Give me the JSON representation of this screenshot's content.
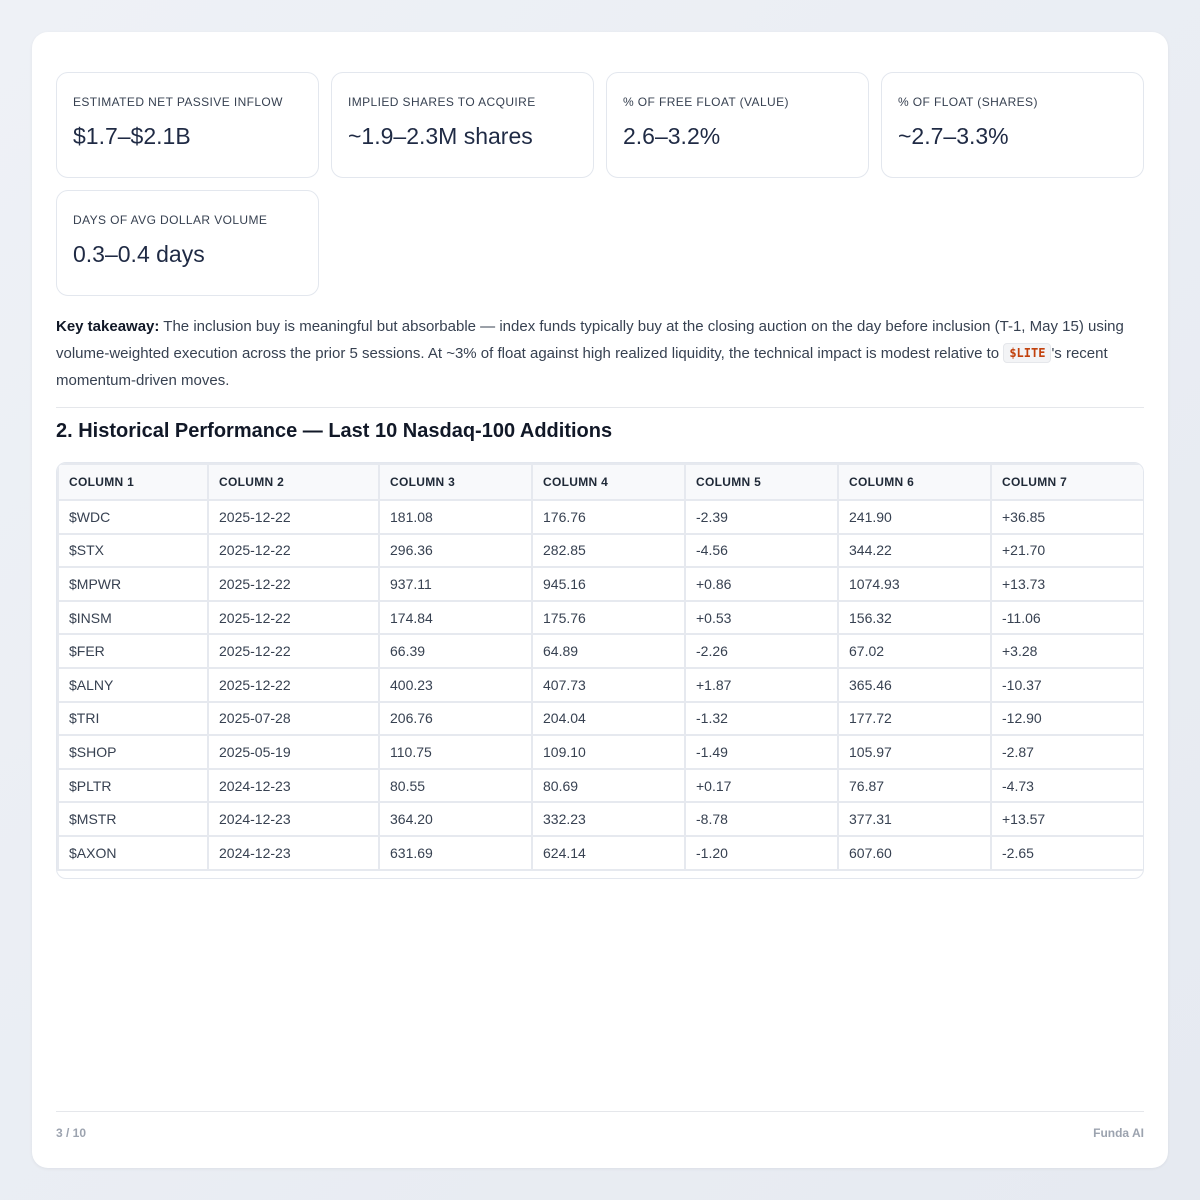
{
  "metrics": [
    {
      "label": "Estimated Net Passive Inflow",
      "value": "$1.7–$2.1B"
    },
    {
      "label": "Implied Shares to Acquire",
      "value": "~1.9–2.3M shares"
    },
    {
      "label": "% of Free Float (Value)",
      "value": "2.6–3.2%"
    },
    {
      "label": "% of Float (Shares)",
      "value": "~2.7–3.3%"
    },
    {
      "label": "Days of Avg Dollar Volume",
      "value": "0.3–0.4 days"
    }
  ],
  "takeaway": {
    "label": "Key takeaway:",
    "text_before": " The inclusion buy is meaningful but absorbable — index funds typically buy at the closing auction on the day before inclusion (T-1, May 15) using volume-weighted execution across the prior 5 sessions. At ~3% of float against high realized liquidity, the technical impact is modest relative to ",
    "ticker": "$LITE",
    "text_after": "'s recent momentum-driven moves."
  },
  "section_title": "2. Historical Performance — Last 10 Nasdaq-100 Additions",
  "table": {
    "headers": [
      "Column 1",
      "Column 2",
      "Column 3",
      "Column 4",
      "Column 5",
      "Column 6",
      "Column 7"
    ],
    "rows": [
      [
        "$WDC",
        "2025-12-22",
        "181.08",
        "176.76",
        "-2.39",
        "241.90",
        "+36.85"
      ],
      [
        "$STX",
        "2025-12-22",
        "296.36",
        "282.85",
        "-4.56",
        "344.22",
        "+21.70"
      ],
      [
        "$MPWR",
        "2025-12-22",
        "937.11",
        "945.16",
        "+0.86",
        "1074.93",
        "+13.73"
      ],
      [
        "$INSM",
        "2025-12-22",
        "174.84",
        "175.76",
        "+0.53",
        "156.32",
        "-11.06"
      ],
      [
        "$FER",
        "2025-12-22",
        "66.39",
        "64.89",
        "-2.26",
        "67.02",
        "+3.28"
      ],
      [
        "$ALNY",
        "2025-12-22",
        "400.23",
        "407.73",
        "+1.87",
        "365.46",
        "-10.37"
      ],
      [
        "$TRI",
        "2025-07-28",
        "206.76",
        "204.04",
        "-1.32",
        "177.72",
        "-12.90"
      ],
      [
        "$SHOP",
        "2025-05-19",
        "110.75",
        "109.10",
        "-1.49",
        "105.97",
        "-2.87"
      ],
      [
        "$PLTR",
        "2024-12-23",
        "80.55",
        "80.69",
        "+0.17",
        "76.87",
        "-4.73"
      ],
      [
        "$MSTR",
        "2024-12-23",
        "364.20",
        "332.23",
        "-8.78",
        "377.31",
        "+13.57"
      ],
      [
        "$AXON",
        "2024-12-23",
        "631.69",
        "624.14",
        "-1.20",
        "607.60",
        "-2.65"
      ]
    ]
  },
  "footer": {
    "page": "3 / 10",
    "brand": "Funda AI"
  }
}
